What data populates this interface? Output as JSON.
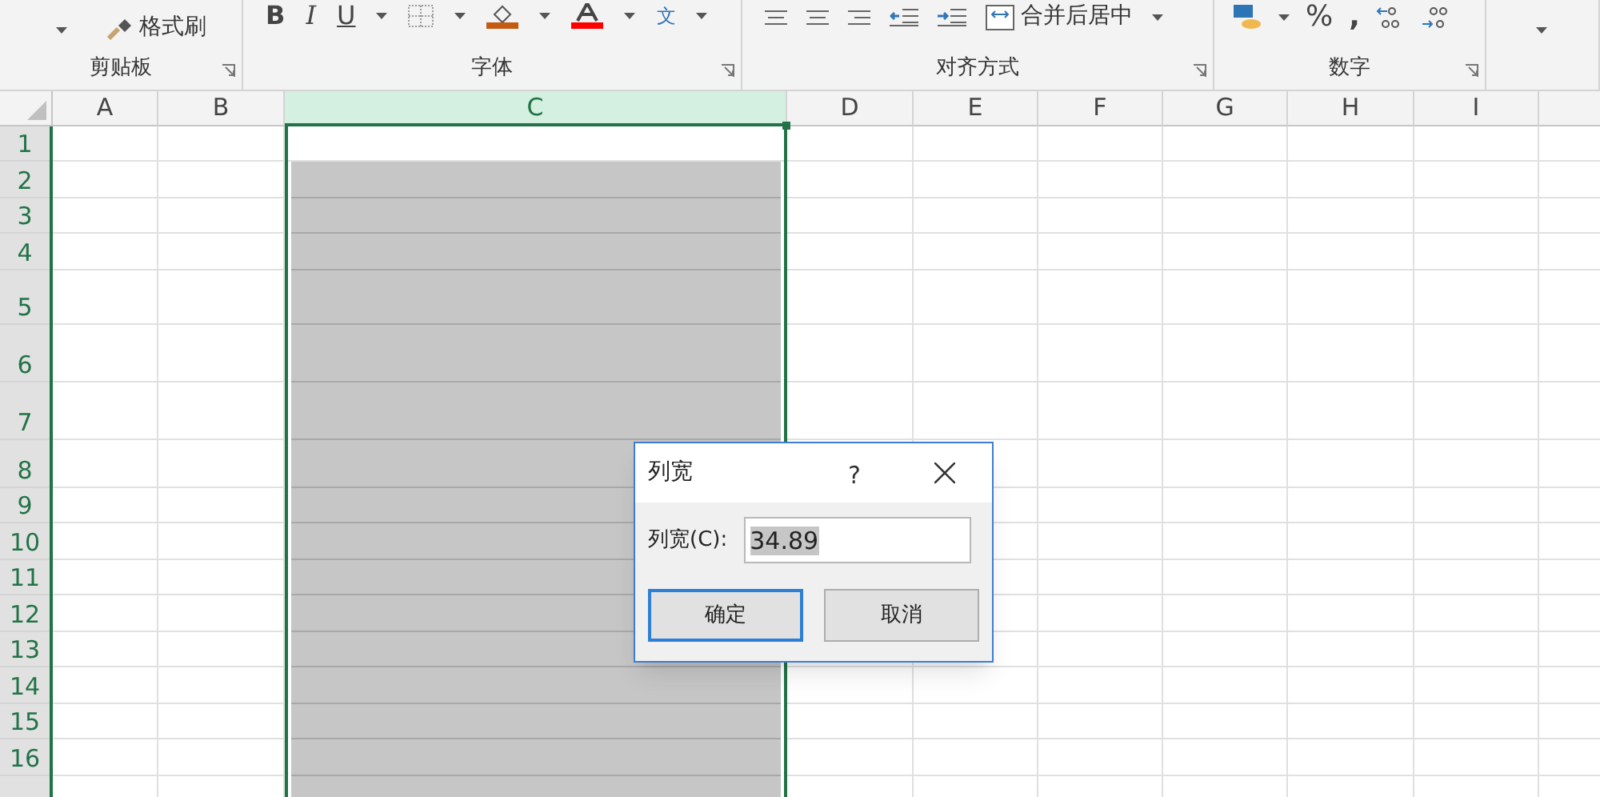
{
  "ribbon": {
    "groups": [
      {
        "label": "剪贴板",
        "format_painter": "格式刷"
      },
      {
        "label": "字体",
        "bold": "B",
        "italic": "I",
        "underline": "U",
        "phonetic": "文"
      },
      {
        "label": "对齐方式",
        "merge": "合并后居中"
      },
      {
        "label": "数字",
        "percent": "%",
        "comma": ","
      },
      {
        "kind": "styles"
      }
    ]
  },
  "sheet": {
    "columns": [
      {
        "label": "A",
        "selected": false
      },
      {
        "label": "B",
        "selected": false
      },
      {
        "label": "C",
        "selected": true
      },
      {
        "label": "D",
        "selected": false
      },
      {
        "label": "E",
        "selected": false
      },
      {
        "label": "F",
        "selected": false
      },
      {
        "label": "G",
        "selected": false
      },
      {
        "label": "H",
        "selected": false
      },
      {
        "label": "I",
        "selected": false
      },
      {
        "selected": false
      }
    ],
    "rows": [
      "1",
      "2",
      "3",
      "4",
      "5",
      "6",
      "7",
      "8",
      "9",
      "10",
      "11",
      "12",
      "13",
      "14",
      "15",
      "16"
    ]
  },
  "dialog": {
    "title": "列宽",
    "help": "?",
    "field_label": "列宽(C):",
    "value": "34.89",
    "buttons": [
      {
        "label": "确定",
        "default": true
      },
      {
        "label": "取消",
        "default": false
      }
    ]
  }
}
